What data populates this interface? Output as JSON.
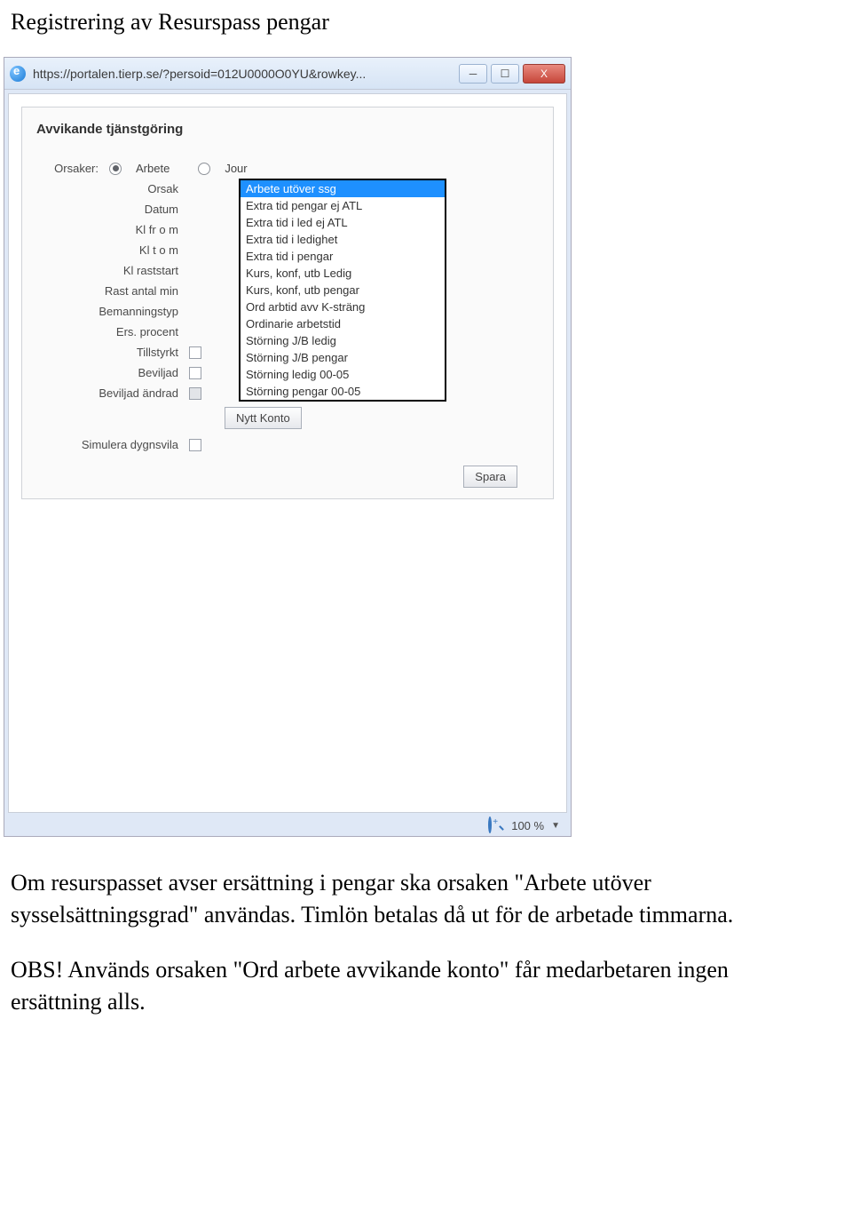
{
  "page_title": "Registrering av Resurspass pengar",
  "window": {
    "url_text": "https://portalen.tierp.se/?persoid=012U0000O0YU&rowkey...",
    "buttons": {
      "min": "─",
      "max": "☐",
      "close": "X"
    }
  },
  "form": {
    "section_title": "Avvikande tjänstgöring",
    "orsaker_label": "Orsaker:",
    "radios": {
      "arbete": "Arbete",
      "jour": "Jour",
      "selected": "arbete"
    },
    "labels": {
      "orsak": "Orsak",
      "datum": "Datum",
      "kl_from": "Kl fr o m",
      "kl_tom": "Kl t o m",
      "kl_raststart": "Kl raststart",
      "rast_antal": "Rast antal min",
      "bemanningstyp": "Bemanningstyp",
      "ers_procent": "Ers. procent",
      "tillstyrkt": "Tillstyrkt",
      "beviljad": "Beviljad",
      "beviljad_andrad": "Beviljad ändrad",
      "simulera": "Simulera dygnsvila"
    },
    "dropdown": {
      "options": [
        "Arbete utöver ssg",
        "Extra tid pengar ej ATL",
        "Extra tid i led ej ATL",
        "Extra tid i ledighet",
        "Extra tid i pengar",
        "Kurs, konf, utb Ledig",
        "Kurs, konf, utb pengar",
        "Ord arbtid avv K-sträng",
        "Ordinarie arbetstid",
        "Störning J/B ledig",
        "Störning J/B pengar",
        "Störning ledig 00-05",
        "Störning pengar 00-05"
      ],
      "selected_index": 0
    },
    "buttons": {
      "nytt_konto": "Nytt Konto",
      "spara": "Spara"
    }
  },
  "statusbar": {
    "zoom_text": "100 %",
    "arrow": "▼"
  },
  "body": {
    "p1": "Om resurspasset avser ersättning i pengar ska orsaken \"Arbete utöver sysselsättningsgrad\" användas. Timlön betalas då ut för de arbetade timmarna.",
    "p2": "OBS! Används orsaken \"Ord arbete avvikande konto\" får medarbetaren ingen ersättning alls."
  }
}
